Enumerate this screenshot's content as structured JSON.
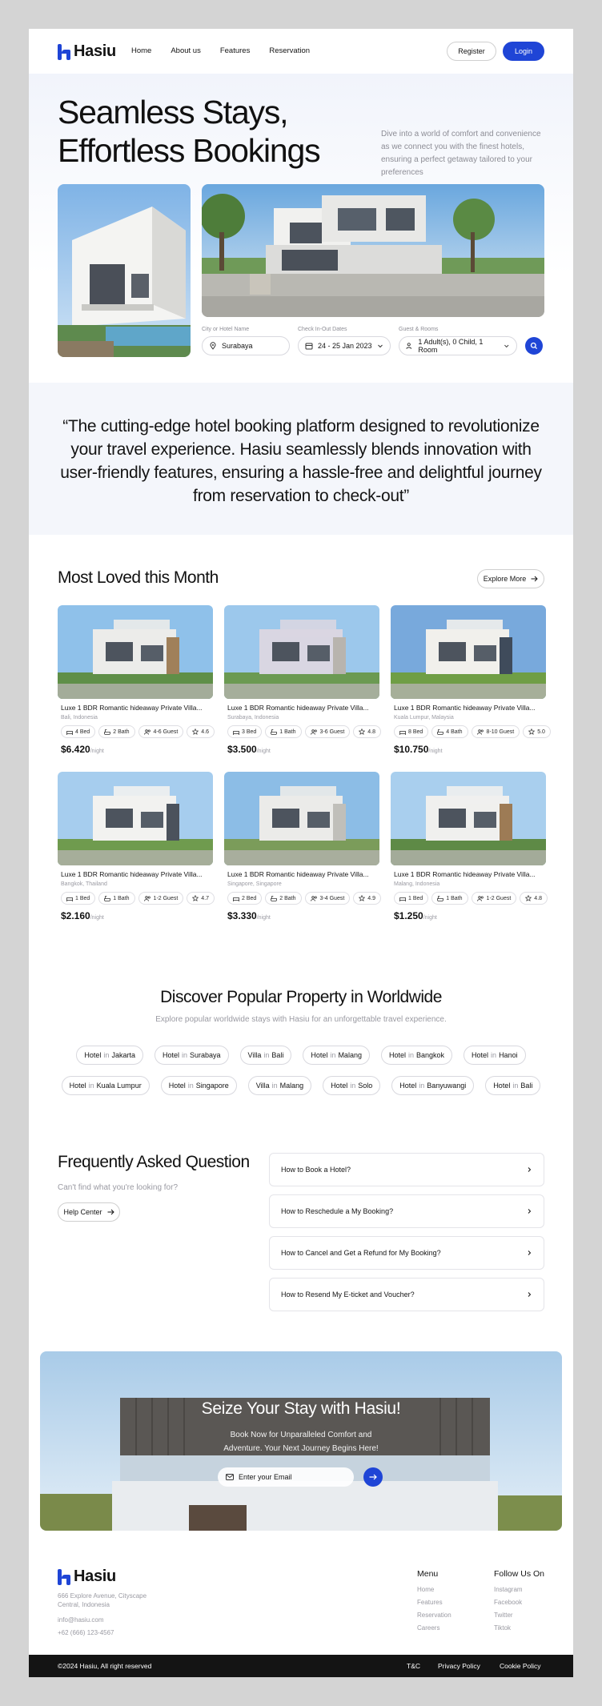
{
  "brand": {
    "name": "Hasiu",
    "accent": "#1f45d6"
  },
  "nav": {
    "links": [
      "Home",
      "About us",
      "Features",
      "Reservation"
    ],
    "register": "Register",
    "login": "Login"
  },
  "hero": {
    "title_line1": "Seamless Stays,",
    "title_line2": "Effortless Bookings",
    "description": "Dive into a world of comfort and convenience as we connect you with the finest hotels, ensuring a perfect getaway tailored to your preferences"
  },
  "search": {
    "city_label": "City or Hotel Name",
    "city_value": "Surabaya",
    "dates_label": "Check In-Out Dates",
    "dates_value": "24 - 25 Jan 2023",
    "guest_label": "Guest & Rooms",
    "guest_value": "1 Adult(s), 0 Child, 1 Room"
  },
  "quote": "“The cutting-edge hotel booking platform designed to revolutionize your travel experience. Hasiu seamlessly blends innovation with user-friendly features, ensuring a hassle-free and delightful journey from reservation to check-out”",
  "most_loved": {
    "title": "Most Loved this Month",
    "explore": "Explore More",
    "per_night": "/night",
    "cards": [
      {
        "title": "Luxe 1 BDR Romantic hideaway Private Villa...",
        "location": "Bali, Indonesia",
        "bed": "4 Bed",
        "bath": "2 Bath",
        "guest": "4-6 Guest",
        "rating": "4.6",
        "price": "$6.420"
      },
      {
        "title": "Luxe 1 BDR Romantic hideaway Private Villa...",
        "location": "Surabaya, Indonesia",
        "bed": "3 Bed",
        "bath": "1 Bath",
        "guest": "3-6 Guest",
        "rating": "4.8",
        "price": "$3.500"
      },
      {
        "title": "Luxe 1 BDR Romantic hideaway Private Villa...",
        "location": "Kuala Lumpur, Malaysia",
        "bed": "8 Bed",
        "bath": "4 Bath",
        "guest": "8-10 Guest",
        "rating": "5.0",
        "price": "$10.750"
      },
      {
        "title": "Luxe 1 BDR Romantic hideaway Private Villa...",
        "location": "Bangkok, Thailand",
        "bed": "1 Bed",
        "bath": "1 Bath",
        "guest": "1-2 Guest",
        "rating": "4.7",
        "price": "$2.160"
      },
      {
        "title": "Luxe 1 BDR Romantic hideaway Private Villa...",
        "location": "Singapore, Singapore",
        "bed": "2 Bed",
        "bath": "2 Bath",
        "guest": "3-4 Guest",
        "rating": "4.9",
        "price": "$3.330"
      },
      {
        "title": "Luxe 1 BDR Romantic hideaway Private Villa...",
        "location": "Malang, Indonesia",
        "bed": "1 Bed",
        "bath": "1 Bath",
        "guest": "1-2 Guest",
        "rating": "4.8",
        "price": "$1.250"
      }
    ]
  },
  "discover": {
    "title": "Discover Popular Property in Worldwide",
    "subtitle": "Explore popular worldwide stays with Hasiu for an unforgettable travel experience.",
    "row1": [
      {
        "type": "Hotel",
        "city": "Jakarta"
      },
      {
        "type": "Hotel",
        "city": "Surabaya"
      },
      {
        "type": "Villa",
        "city": "Bali"
      },
      {
        "type": "Hotel",
        "city": "Malang"
      },
      {
        "type": "Hotel",
        "city": "Bangkok"
      },
      {
        "type": "Hotel",
        "city": "Hanoi"
      }
    ],
    "row2": [
      {
        "type": "Hotel",
        "city": "Kuala Lumpur"
      },
      {
        "type": "Hotel",
        "city": "Singapore"
      },
      {
        "type": "Villa",
        "city": "Malang"
      },
      {
        "type": "Hotel",
        "city": "Solo"
      },
      {
        "type": "Hotel",
        "city": "Banyuwangi"
      },
      {
        "type": "Hotel",
        "city": "Bali"
      }
    ],
    "in_word": "in"
  },
  "faq": {
    "title": "Frequently Asked Question",
    "subtitle": "Can't find what you're looking for?",
    "help": "Help Center",
    "items": [
      "How to Book a Hotel?",
      "How to Reschedule a My Booking?",
      "How to Cancel and Get a Refund for My Booking?",
      "How to Resend My E-ticket and Voucher?"
    ]
  },
  "cta": {
    "title": "Seize Your Stay with Hasiu!",
    "subtitle": "Book Now for Unparalleled Comfort and Adventure. Your Next Journey Begins Here!",
    "email_placeholder": "Enter your Email"
  },
  "footer": {
    "address": "666 Explore Avenue, Cityscape Central, Indonesia",
    "email": "info@hasiu.com",
    "phone": "+62 (666) 123-4567",
    "menu_title": "Menu",
    "menu": [
      "Home",
      "Features",
      "Reservation",
      "Careers"
    ],
    "follow_title": "Follow Us On",
    "follow": [
      "Instagram",
      "Facebook",
      "Twitter",
      "Tiktok"
    ],
    "copyright": "©2024 Hasiu, All right reserved",
    "legal": [
      "T&C",
      "Privacy Policy",
      "Cookie Policy"
    ]
  }
}
